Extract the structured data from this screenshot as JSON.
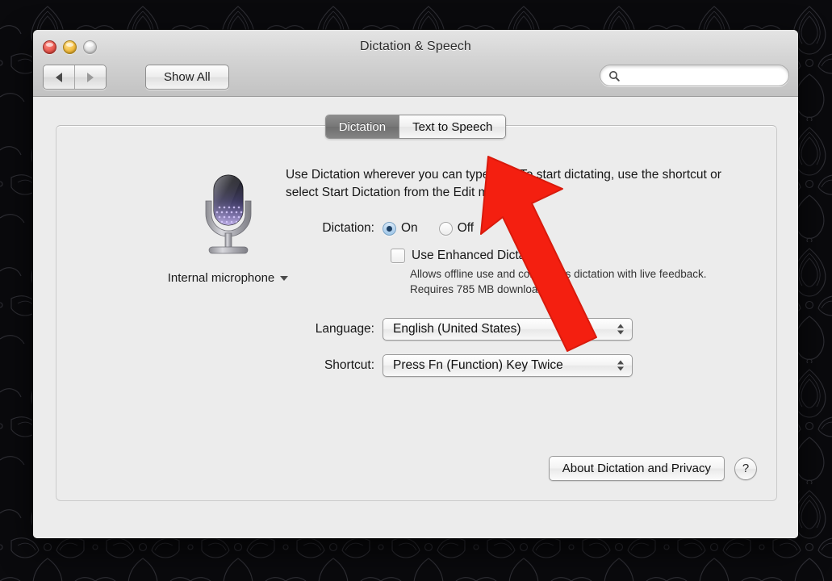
{
  "window": {
    "title": "Dictation & Speech",
    "traffic_lights": [
      "close",
      "minimize",
      "zoom"
    ]
  },
  "toolbar": {
    "back_label": "Back",
    "forward_label": "Forward",
    "show_all_label": "Show All",
    "search": {
      "value": "",
      "placeholder": "",
      "icon": "search-icon"
    }
  },
  "tabs": [
    {
      "label": "Dictation",
      "selected": true
    },
    {
      "label": "Text to Speech",
      "selected": false
    }
  ],
  "microphone": {
    "icon": "microphone-icon",
    "source_label": "Internal microphone",
    "caret_icon": "chevron-down-icon"
  },
  "pane": {
    "intro_text": "Use Dictation wherever you can type text. To start dictating, use the shortcut or select Start Dictation from the Edit menu.",
    "dictation_label": "Dictation:",
    "radio_on_label": "On",
    "radio_off_label": "Off",
    "dictation_value": "On",
    "enhanced_label": "Use Enhanced Dictation",
    "enhanced_checked": "false",
    "enhanced_note": "Allows offline use and continuous dictation with live feedback. Requires 785 MB download.",
    "language_label": "Language:",
    "language_value": "English (United States)",
    "shortcut_label": "Shortcut:",
    "shortcut_value": "Press Fn (Function) Key Twice"
  },
  "footer": {
    "about_label": "About Dictation and Privacy",
    "help_label": "?"
  },
  "annotation": {
    "arrow_color": "#f41f10",
    "arrow_direction": "up-left"
  },
  "colors": {
    "accent_blue": "#1d3f63",
    "arrow_red": "#f41f10",
    "selected_tab": "#777777",
    "window_chrome": "#d3d3d3",
    "pane_bg": "#ececec",
    "desktop_bg": "#0b0b0e"
  }
}
